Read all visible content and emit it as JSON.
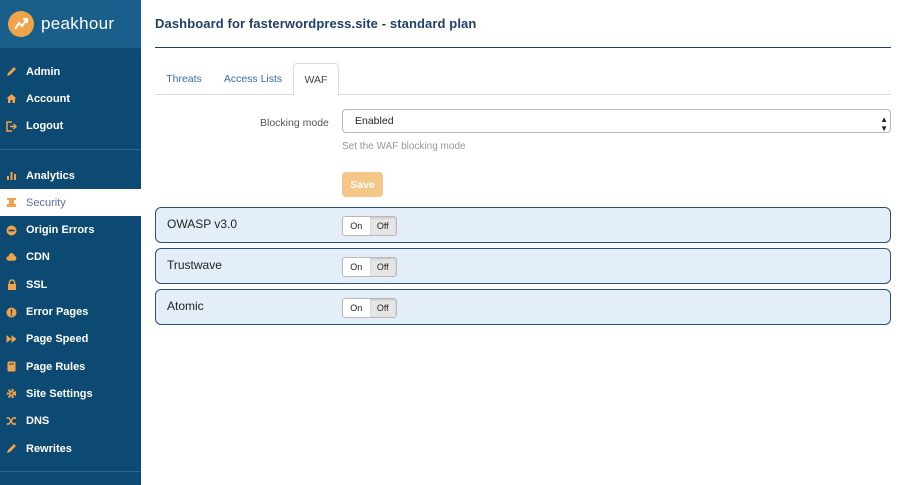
{
  "brand": {
    "name": "peakhour",
    "logo_color": "#f0a347"
  },
  "sidebar": {
    "account_items": [
      {
        "label": "Admin",
        "icon": "pencil-icon"
      },
      {
        "label": "Account",
        "icon": "home-icon"
      },
      {
        "label": "Logout",
        "icon": "logout-icon"
      }
    ],
    "site_items": [
      {
        "label": "Analytics",
        "icon": "bar-chart-icon"
      },
      {
        "label": "Security",
        "icon": "shield-icon",
        "active": true
      },
      {
        "label": "Origin Errors",
        "icon": "minus-circle-icon"
      },
      {
        "label": "CDN",
        "icon": "cloud-icon"
      },
      {
        "label": "SSL",
        "icon": "lock-icon"
      },
      {
        "label": "Error Pages",
        "icon": "exclamation-icon"
      },
      {
        "label": "Page Speed",
        "icon": "fast-forward-icon"
      },
      {
        "label": "Page Rules",
        "icon": "book-icon"
      },
      {
        "label": "Site Settings",
        "icon": "gear-icon"
      },
      {
        "label": "DNS",
        "icon": "shuffle-icon"
      },
      {
        "label": "Rewrites",
        "icon": "pencil-icon"
      }
    ]
  },
  "header": {
    "title": "Dashboard for fasterwordpress.site - standard plan"
  },
  "tabs": [
    {
      "label": "Threats"
    },
    {
      "label": "Access Lists"
    },
    {
      "label": "WAF",
      "active": true
    }
  ],
  "waf": {
    "blocking_mode_label": "Blocking mode",
    "blocking_mode_value": "Enabled",
    "help_text": "Set the WAF blocking mode",
    "save_label": "Save"
  },
  "rulesets": [
    {
      "name": "OWASP v3.0",
      "on_label": "On",
      "off_label": "Off",
      "selected": "off"
    },
    {
      "name": "Trustwave",
      "on_label": "On",
      "off_label": "Off",
      "selected": "off"
    },
    {
      "name": "Atomic",
      "on_label": "On",
      "off_label": "Off",
      "selected": "off"
    }
  ],
  "colors": {
    "sidebar_bg": "#0d4a73",
    "accent": "#f0a347",
    "card_bg": "#e4eef8",
    "card_border": "#27507d"
  }
}
